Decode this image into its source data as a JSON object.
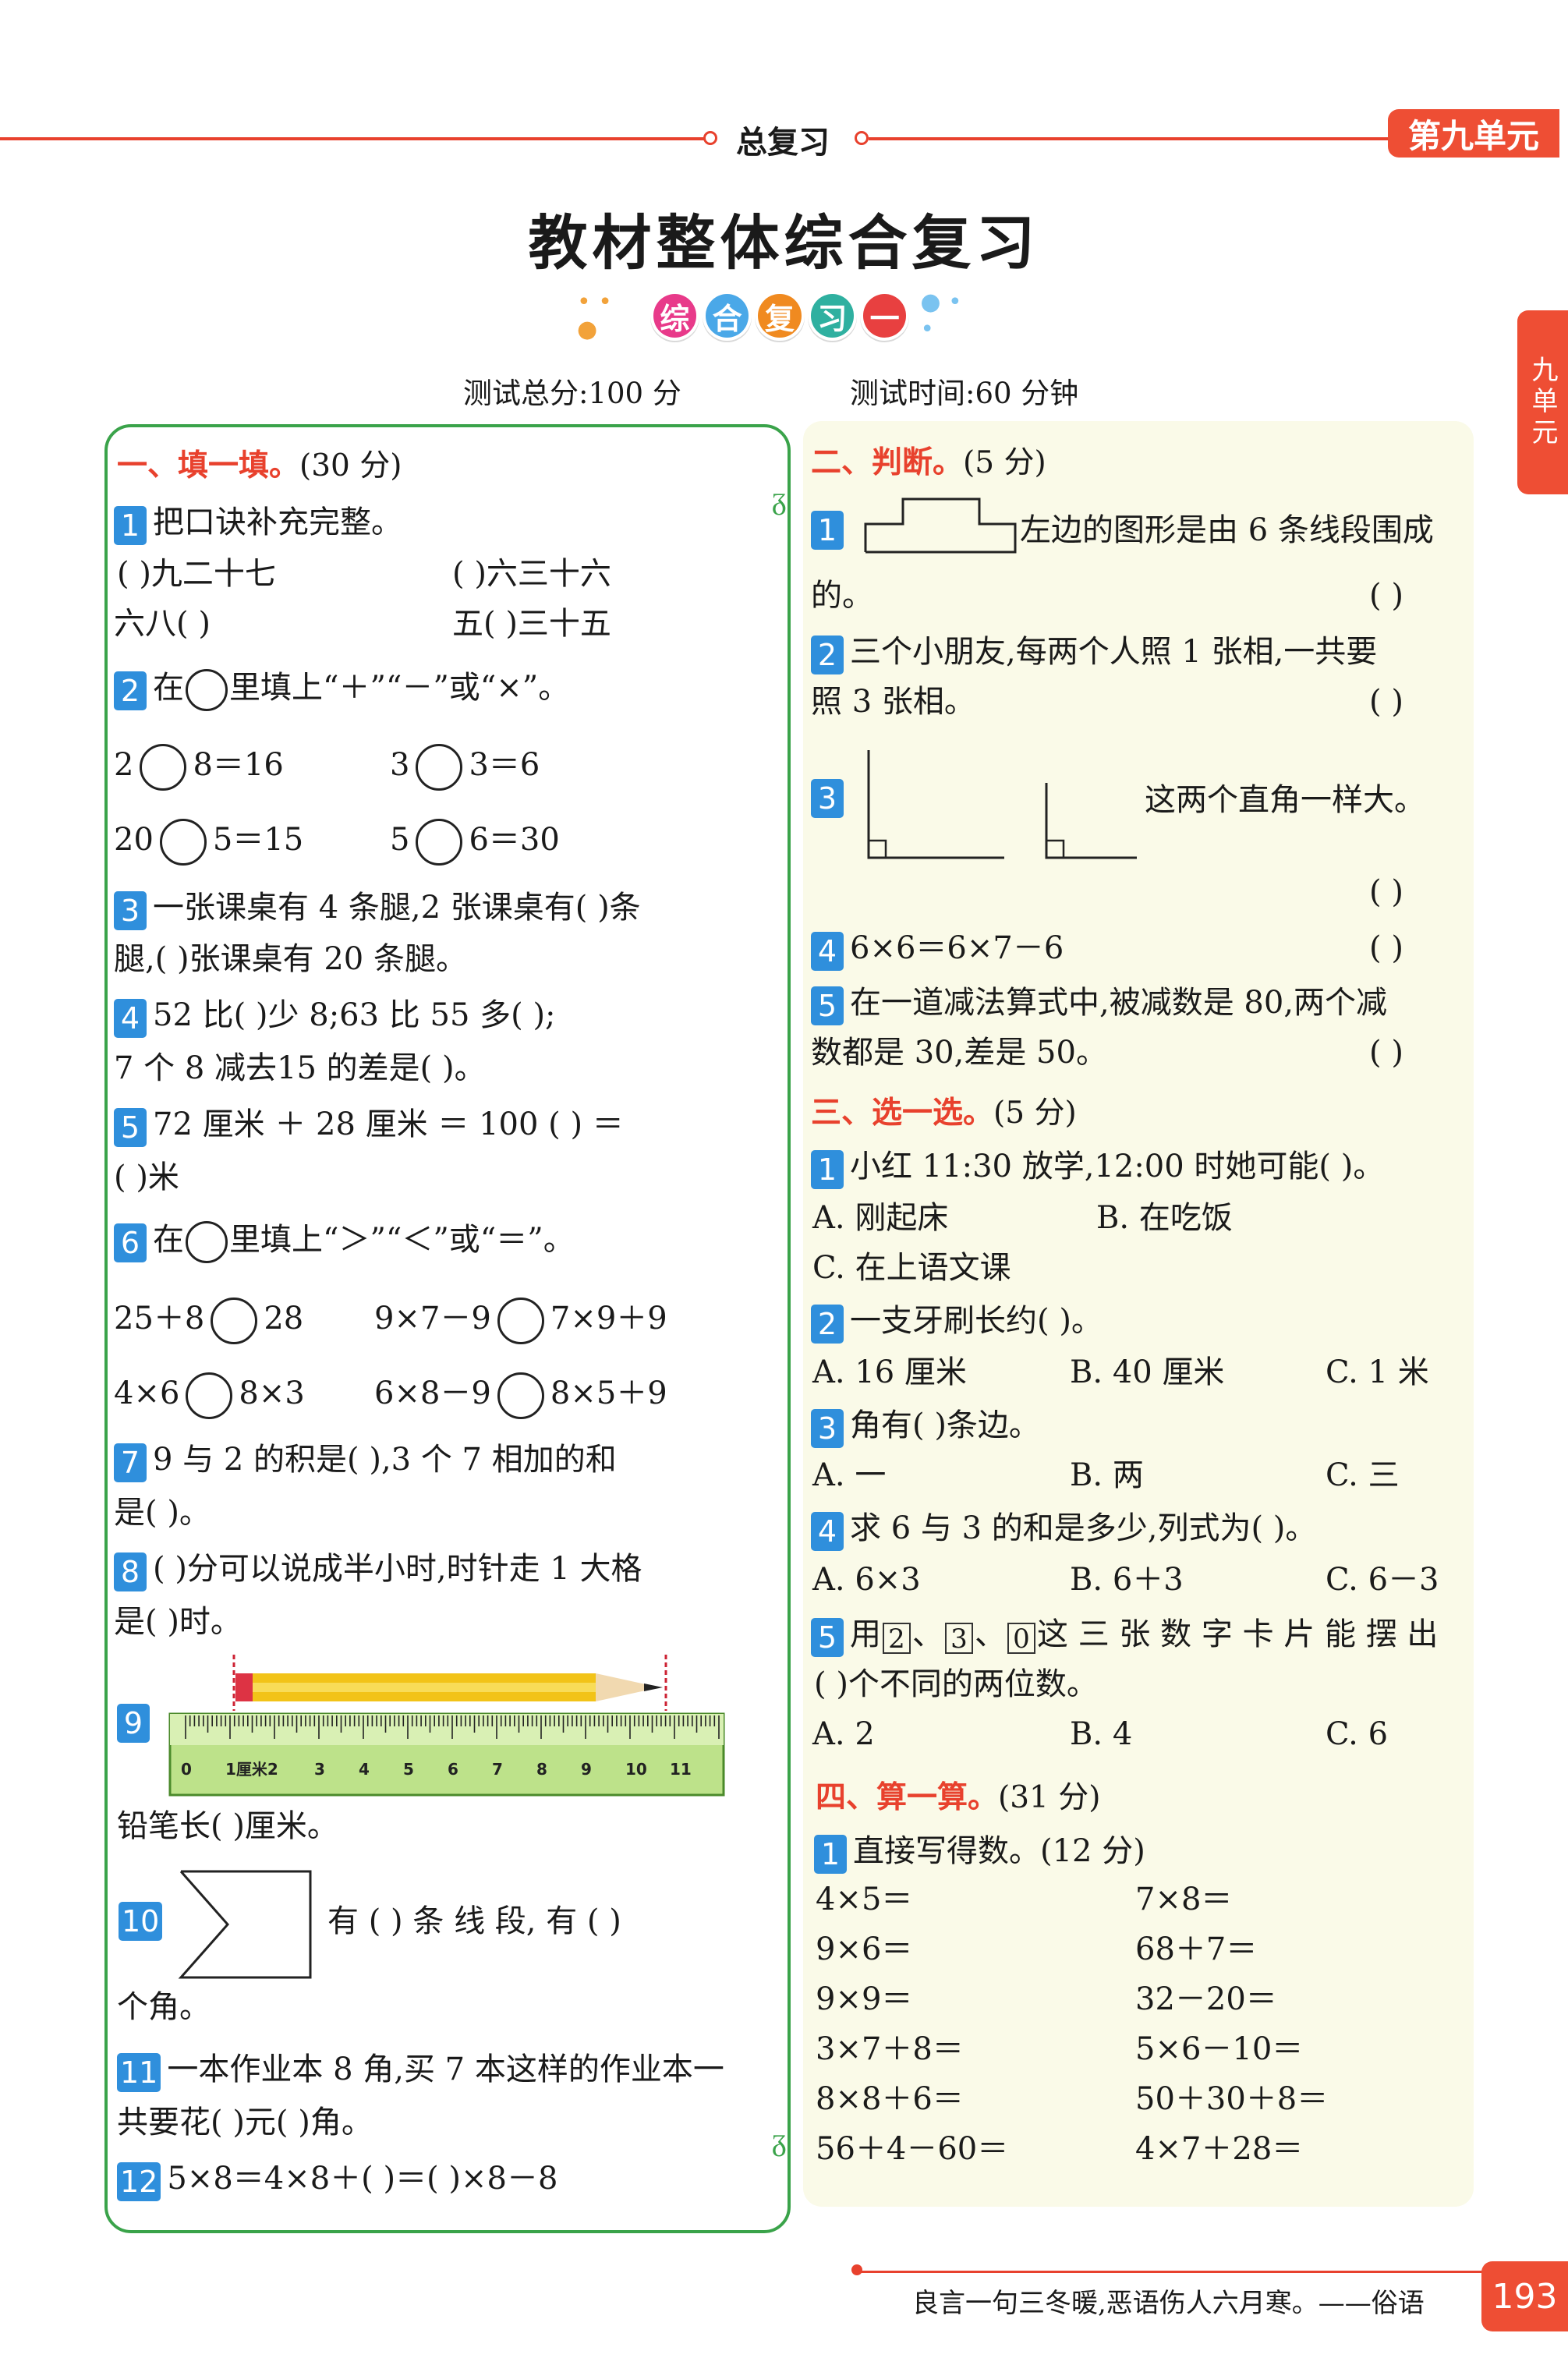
{
  "header": {
    "label": "总复习",
    "unit_badge": "第九单元",
    "side_tab": "九单元"
  },
  "title": "教材整体综合复习",
  "subtitle_chars": [
    "综",
    "合",
    "复",
    "习",
    "一"
  ],
  "subtitle_colors": [
    "#e83a8a",
    "#4aa8e8",
    "#f08a20",
    "#2fb0a0",
    "#e84040"
  ],
  "meta": {
    "score": "测试总分:100 分",
    "time": "测试时间:60 分钟"
  },
  "left": {
    "s1": {
      "head": "一、填一填。",
      "pts": "(30 分)"
    },
    "q1": {
      "num": "1",
      "text": "把口诀补充完整。",
      "l1a": "(        )九二十七",
      "l1b": "(        )六三十六",
      "l2a": "六八(           )",
      "l2b": "五(           )三十五"
    },
    "q2": {
      "num": "2",
      "pre": "在",
      "post": "里填上“＋”“－”或“×”。",
      "a1": "2",
      "a2": "8＝16",
      "b1": "3",
      "b2": "3＝6",
      "c1": "20",
      "c2": "5＝15",
      "d1": "5",
      "d2": "6＝30"
    },
    "q3": {
      "num": "3",
      "l1": "一张课桌有 4 条腿,2 张课桌有(        )条",
      "l2": "腿,(      )张课桌有 20 条腿。"
    },
    "q4": {
      "num": "4",
      "l1": "52 比(        )少 8;63 比 55 多(        );",
      "l2": "7 个 8 减去15 的差是(      )。"
    },
    "q5": {
      "num": "5",
      "l1": "72 厘米 ＋ 28 厘米 ＝ 100 (        ) ＝",
      "l2": "(      )米"
    },
    "q6": {
      "num": "6",
      "pre": "在",
      "post": "里填上“＞”“＜”或“＝”。",
      "a1": "25＋8",
      "a2": "28",
      "b1": "9×7－9",
      "b2": "7×9＋9",
      "c1": "4×6",
      "c2": "8×3",
      "d1": "6×8－9",
      "d2": "8×5＋9"
    },
    "q7": {
      "num": "7",
      "l1": "9 与 2 的积是(        ),3 个 7 相加的和",
      "l2": "是(      )。"
    },
    "q8": {
      "num": "8",
      "l1": "(      )分可以说成半小时,时针走 1 大格",
      "l2": "是(      )时。"
    },
    "q9": {
      "num": "9",
      "ruler_labels": [
        "0",
        "1厘米2",
        "3",
        "4",
        "5",
        "6",
        "7",
        "8",
        "9",
        "10",
        "11"
      ],
      "answer": "铅笔长(        )厘米。"
    },
    "q10": {
      "num": "10",
      "l1": "有 (        ) 条 线 段, 有 (        )",
      "l2": "个角。"
    },
    "q11": {
      "num": "11",
      "l1": "一本作业本 8 角,买 7 本这样的作业本一",
      "l2": "共要花(        )元(        )角。"
    },
    "q12": {
      "num": "12",
      "l1": "5×8＝4×8＋(        )＝(        )×8－8"
    }
  },
  "right": {
    "s2": {
      "head": "二、判断。",
      "pts": "(5 分)"
    },
    "j1": {
      "num": "1",
      "l1": "左边的图形是由 6 条线段围成",
      "l2": "的。",
      "paren": "(        )"
    },
    "j2": {
      "num": "2",
      "l1": "三个小朋友,每两个人照 1 张相,一共要",
      "l2": "照 3 张相。",
      "paren": "(        )"
    },
    "j3": {
      "num": "3",
      "text": "这两个直角一样大。",
      "paren": "(        )"
    },
    "j4": {
      "num": "4",
      "text": "6×6＝6×7－6",
      "paren": "(        )"
    },
    "j5": {
      "num": "5",
      "l1": "在一道减法算式中,被减数是 80,两个减",
      "l2": "数都是 30,差是 50。",
      "paren": "(        )"
    },
    "s3": {
      "head": "三、选一选。",
      "pts": "(5 分)"
    },
    "c1": {
      "num": "1",
      "text": "小红 11:30 放学,12:00 时她可能(        )。",
      "a": "A. 刚起床",
      "b": "B. 在吃饭",
      "c": "C. 在上语文课"
    },
    "c2": {
      "num": "2",
      "text": "一支牙刷长约(        )。",
      "a": "A. 16 厘米",
      "b": "B. 40 厘米",
      "c": "C. 1 米"
    },
    "c3": {
      "num": "3",
      "text": "角有(        )条边。",
      "a": "A. 一",
      "b": "B. 两",
      "c": "C. 三"
    },
    "c4": {
      "num": "4",
      "text": "求 6 与 3 的和是多少,列式为(        )。",
      "a": "A. 6×3",
      "b": "B. 6＋3",
      "c": "C. 6－3"
    },
    "c5": {
      "num": "5",
      "pre": "用",
      "d1": "2",
      "d2": "3",
      "d3": "0",
      "post": "这 三 张 数 字 卡 片 能 摆 出",
      "l2": "(        )个不同的两位数。",
      "a": "A. 2",
      "b": "B. 4",
      "c": "C. 6"
    },
    "s4": {
      "head": "四、算一算。",
      "pts": "(31 分)"
    },
    "k1": {
      "num": "1",
      "text": "直接写得数。(12 分)"
    },
    "calcs": [
      [
        "4×5＝",
        "7×8＝"
      ],
      [
        "9×6＝",
        "68＋7＝"
      ],
      [
        "9×9＝",
        "32－20＝"
      ],
      [
        "3×7＋8＝",
        "5×6－10＝"
      ],
      [
        "8×8＋6＝",
        "50＋30＋8＝"
      ],
      [
        "56＋4－60＝",
        "4×7＋28＝"
      ]
    ]
  },
  "footer": {
    "quote": "良言一句三冬暖,恶语伤人六月寒。——俗语",
    "page": "193"
  }
}
